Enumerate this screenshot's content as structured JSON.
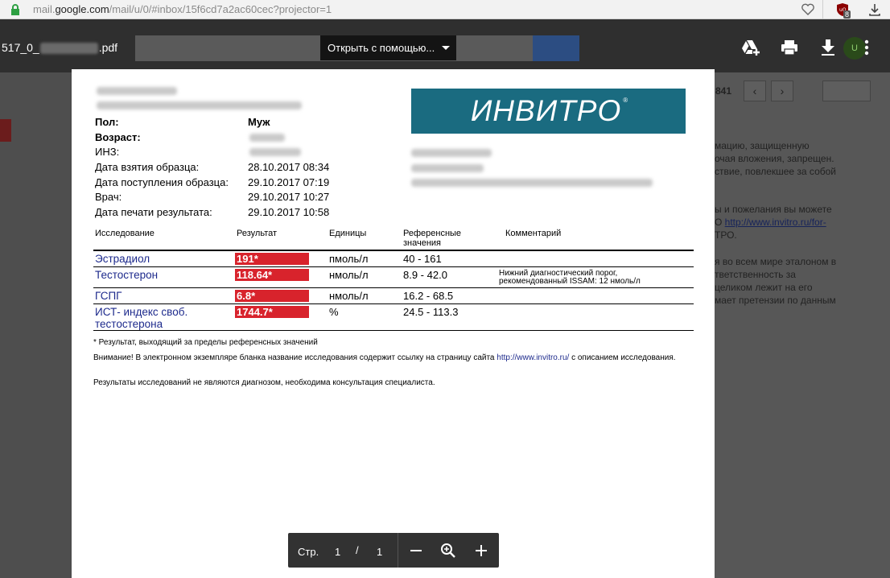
{
  "browser": {
    "url_prefix": "mail.",
    "url_domain": "google.com",
    "url_path": "/mail/u/0/#inbox/15f6cd7a2ac60cec?projector=1",
    "ublock_badge": "8"
  },
  "background": {
    "count": "841",
    "nav_prev": "‹",
    "nav_next": "›",
    "lines": [
      "мацию, защищенную",
      "очая вложения, запрещен.",
      "ствие, повлекшее за собой",
      "ы и пожелания вы можете",
      "ТРО.",
      "я во всем мире эталоном в",
      "тветственность за",
      "целиком лежит на его",
      "мает претензии по данным"
    ],
    "link_prefix": "О ",
    "link": "http://www.invitro.ru/for-"
  },
  "viewer": {
    "filename_prefix": "517_0_",
    "filename_suffix": ".pdf",
    "open_with": "Открыть с помощью...",
    "avatar": "U"
  },
  "document": {
    "logo": "ИНВИТРО",
    "logo_mark": "®",
    "fields": [
      {
        "label": "Пол:",
        "value": "Муж",
        "bold": true
      },
      {
        "label": "Возраст:",
        "value": "",
        "bold": true
      },
      {
        "label": "ИНЗ:",
        "value": "",
        "bold": false
      },
      {
        "label": "Дата взятия образца:",
        "value": "28.10.2017 08:34",
        "bold": false
      },
      {
        "label": "Дата поступления образца:",
        "value": "29.10.2017 07:19",
        "bold": false
      },
      {
        "label": "Врач:",
        "value": "29.10.2017 10:27",
        "bold": false
      },
      {
        "label": "Дата печати результата:",
        "value": "29.10.2017 10:58",
        "bold": false
      }
    ],
    "headers": {
      "study": "Исследование",
      "result": "Результат",
      "units": "Единицы",
      "reference": "Референсные значения",
      "comment": "Комментарий"
    },
    "rows": [
      {
        "name": "Эстрадиол",
        "result": "191*",
        "units": "пмоль/л",
        "reference": "40 - 161",
        "comment": ""
      },
      {
        "name": "Тестостерон",
        "result": "118.64*",
        "units": "нмоль/л",
        "reference": "8.9 - 42.0",
        "comment": "Нижний диагностический порог, рекомендованный ISSAM: 12 нмоль/л"
      },
      {
        "name": "ГСПГ",
        "result": "6.8*",
        "units": "нмоль/л",
        "reference": "16.2 - 68.5",
        "comment": ""
      },
      {
        "name": "ИСТ- индекс своб. тестостерона",
        "result": "1744.7*",
        "units": "%",
        "reference": "24.5 - 113.3",
        "comment": ""
      }
    ],
    "note_star": "* Результат, выходящий за пределы референсных значений",
    "note_attention_pre": "Внимание! В электронном экземпляре бланка название исследования содержит ссылку на страницу сайта ",
    "note_attention_link": "http://www.invitro.ru/",
    "note_attention_post": " с описанием исследования.",
    "note_disclaimer": "Результаты исследований не являются диагнозом, необходима консультация специалиста."
  },
  "pager": {
    "label": "Стр.",
    "current": "1",
    "slash": "/",
    "total": "1"
  }
}
